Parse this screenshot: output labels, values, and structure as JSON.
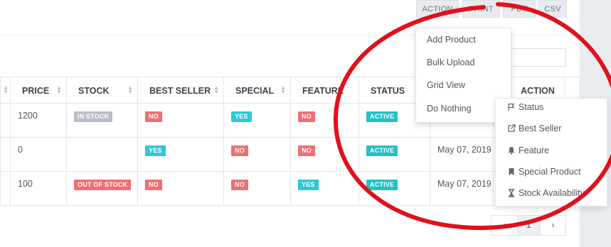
{
  "toolbar": {
    "buttons": [
      "ACTION",
      "PRINT",
      "PDF",
      "CSV"
    ]
  },
  "table": {
    "columns": [
      "PRICE",
      "STOCK",
      "BEST SELLER",
      "SPECIAL",
      "FEATURE",
      "STATUS",
      "",
      "ACTION"
    ],
    "rows": [
      {
        "price": "1200",
        "stock": "IN STOCK",
        "best_seller": "NO",
        "special": "YES",
        "feature": "NO",
        "status": "ACTIVE",
        "date": ""
      },
      {
        "price": "0",
        "stock": "",
        "best_seller": "YES",
        "special": "NO",
        "feature": "NO",
        "status": "ACTIVE",
        "date": "May 07, 2019"
      },
      {
        "price": "100",
        "stock": "OUT OF STOCK",
        "best_seller": "NO",
        "special": "NO",
        "feature": "YES",
        "status": "ACTIVE",
        "date": "May 07, 2019"
      }
    ]
  },
  "action_menu": {
    "items": [
      "Add Product",
      "Bulk Upload",
      "Grid View",
      "Do Nothing"
    ],
    "chevron": "›"
  },
  "submenu": {
    "items": [
      {
        "label": "Status",
        "icon": "flag-icon"
      },
      {
        "label": "Best Seller",
        "icon": "external-link-icon"
      },
      {
        "label": "Feature",
        "icon": "bell-icon"
      },
      {
        "label": "Special Product",
        "icon": "bookmark-icon"
      },
      {
        "label": "Stock Availability",
        "icon": "hourglass-icon"
      }
    ]
  },
  "pagination": {
    "prev": "‹",
    "current": "1",
    "next": "›"
  },
  "colors": {
    "annotation": "#e0101c",
    "badge_red": "#ee6f72",
    "badge_cyan": "#2ec8d8",
    "badge_gray": "#b9bec6"
  }
}
